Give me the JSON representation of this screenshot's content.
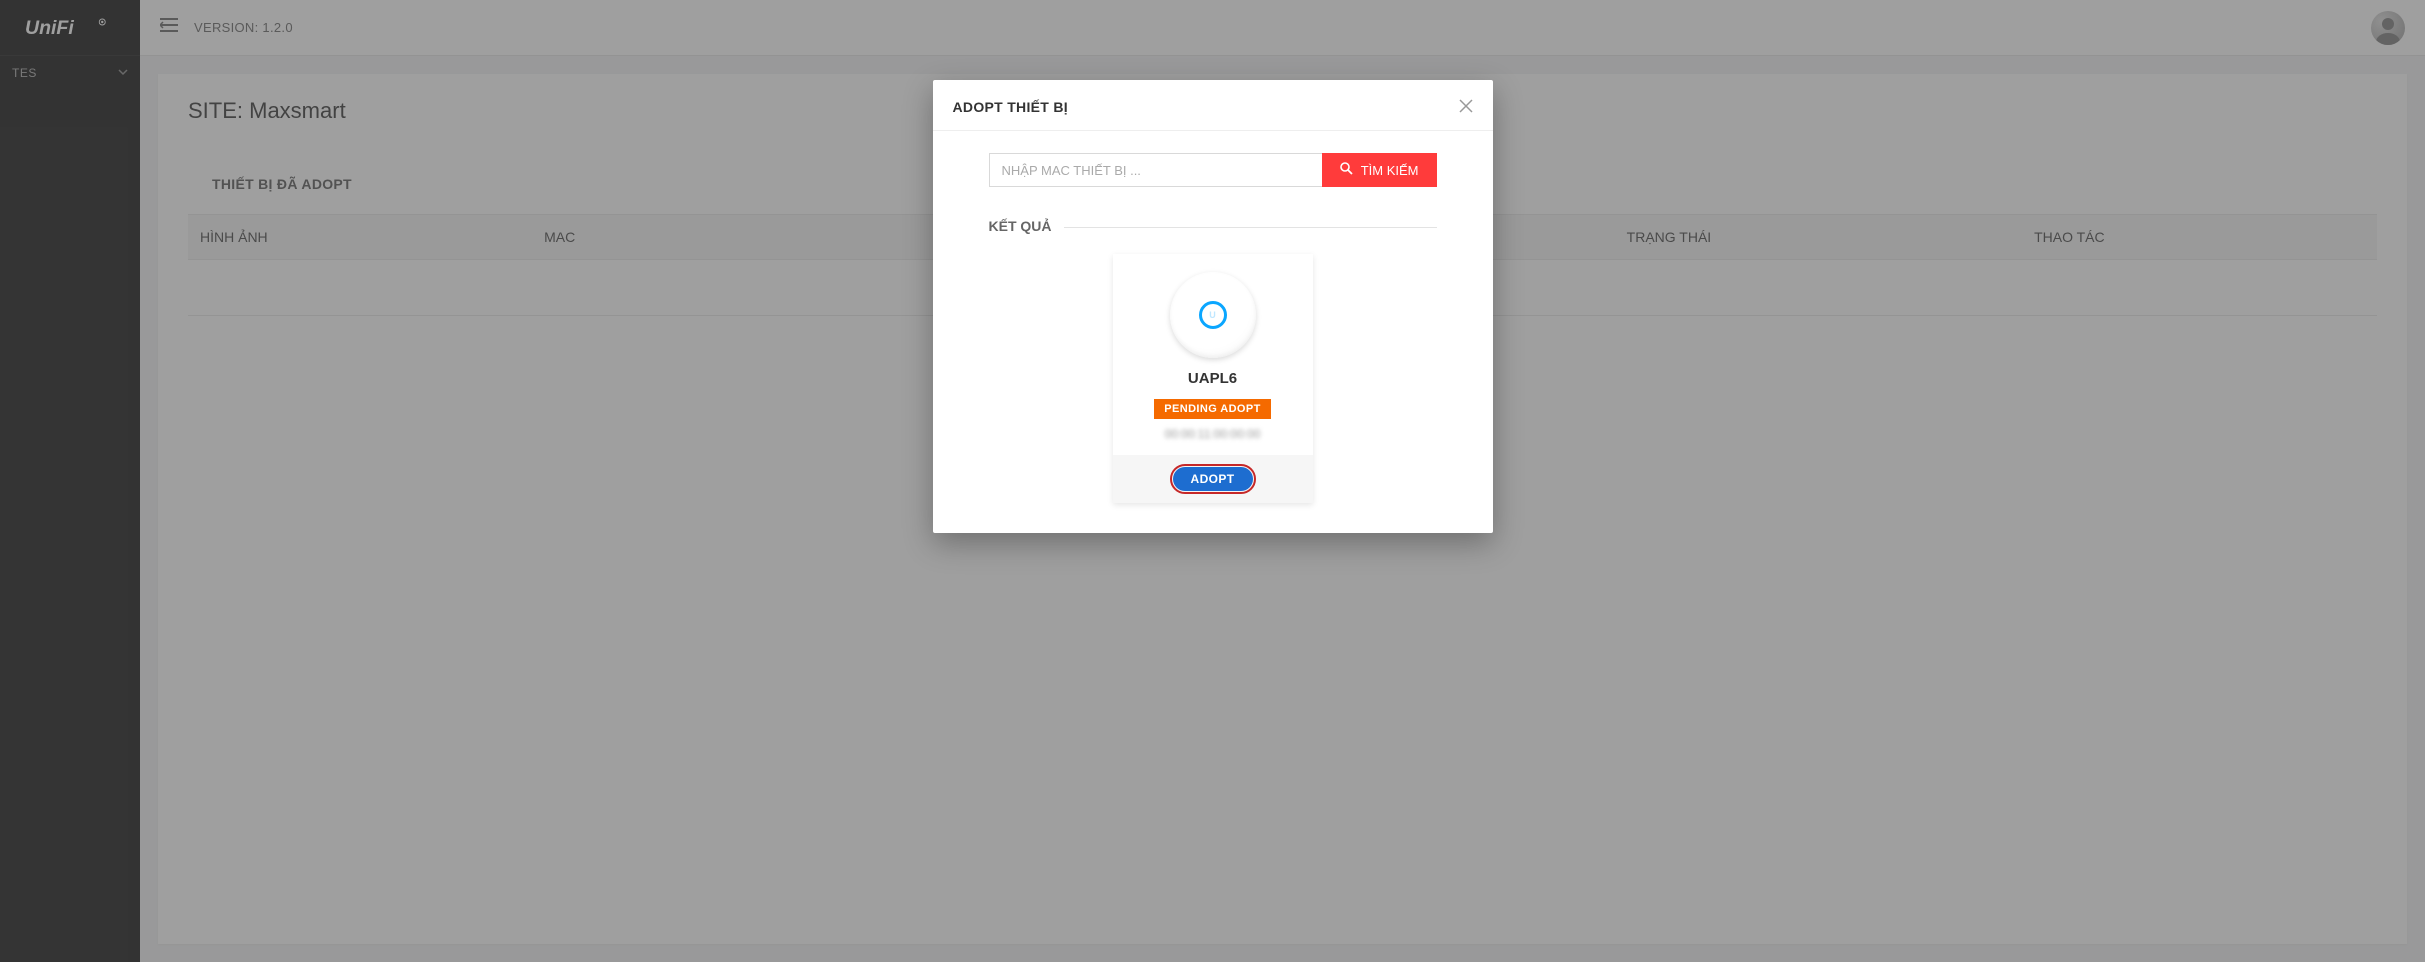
{
  "sidebar": {
    "brand": "UniFi",
    "items": [
      {
        "label": "TES"
      }
    ]
  },
  "topbar": {
    "version": "VERSION: 1.2.0"
  },
  "page": {
    "title": "SITE: Maxsmart",
    "tab_adopted": "THIẾT BỊ ĐÃ ADOPT",
    "columns": {
      "image": "HÌNH ẢNH",
      "mac": "MAC",
      "status": "TRẠNG THÁI",
      "action": "THAO TÁC"
    }
  },
  "modal": {
    "title": "ADOPT THIẾT BỊ",
    "search_placeholder": "NHẬP MAC THIẾT BỊ ...",
    "search_button": "TÌM KIẾM",
    "result_heading": "KẾT QUẢ",
    "device": {
      "name": "UAPL6",
      "status": "PENDING ADOPT",
      "mac": "00:00:11:00:00:00",
      "adopt_button": "ADOPT"
    }
  }
}
